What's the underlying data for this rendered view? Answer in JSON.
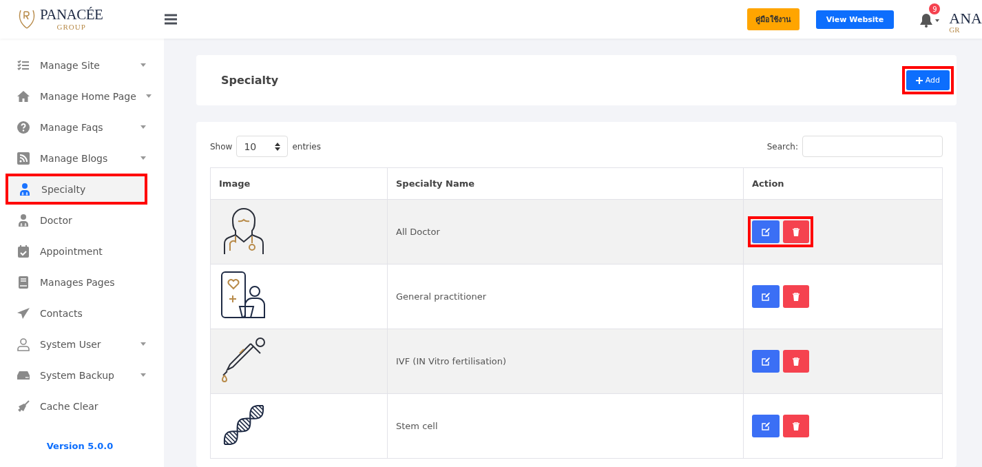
{
  "header": {
    "logo": {
      "name": "PANACÉE",
      "tagline": "GROUP"
    },
    "manual_button": "คู่มือใช้งาน",
    "website_button": "View Website",
    "notifications": {
      "count": "9"
    },
    "profile_logo": {
      "name": "ANA",
      "tagline": "GR"
    }
  },
  "sidebar": {
    "items": [
      {
        "label": "Manage Site",
        "has_submenu": true,
        "selected": false,
        "highlighted": false
      },
      {
        "label": "Manage Home Page",
        "has_submenu": true,
        "selected": false,
        "highlighted": false
      },
      {
        "label": "Manage Faqs",
        "has_submenu": true,
        "selected": false,
        "highlighted": false
      },
      {
        "label": "Manage Blogs",
        "has_submenu": true,
        "selected": false,
        "highlighted": false
      },
      {
        "label": "Specialty",
        "has_submenu": false,
        "selected": true,
        "highlighted": true
      },
      {
        "label": "Doctor",
        "has_submenu": false,
        "selected": false,
        "highlighted": false
      },
      {
        "label": "Appointment",
        "has_submenu": false,
        "selected": false,
        "highlighted": false
      },
      {
        "label": "Manages Pages",
        "has_submenu": false,
        "selected": false,
        "highlighted": false
      },
      {
        "label": "Contacts",
        "has_submenu": false,
        "selected": false,
        "highlighted": false
      },
      {
        "label": "System User",
        "has_submenu": true,
        "selected": false,
        "highlighted": false
      },
      {
        "label": "System Backup",
        "has_submenu": true,
        "selected": false,
        "highlighted": false
      },
      {
        "label": "Cache Clear",
        "has_submenu": false,
        "selected": false,
        "highlighted": false
      }
    ],
    "version": "Version 5.0.0"
  },
  "page_header": {
    "title": "Specialty",
    "add_button": {
      "label": "Add",
      "highlighted": true
    }
  },
  "table_controls": {
    "show_label": "Show",
    "page_size": "10",
    "entries_label": "entries",
    "search_label": "Search:"
  },
  "table": {
    "columns": [
      "Image",
      "Specialty Name",
      "Action"
    ],
    "rows": [
      {
        "kind": "doctor",
        "name": "All Doctor",
        "highlighted": true
      },
      {
        "kind": "telehealth",
        "name": "General practitioner",
        "highlighted": false
      },
      {
        "kind": "dropper",
        "name": "IVF (IN Vitro fertilisation)",
        "highlighted": false
      },
      {
        "kind": "dna",
        "name": "Stem cell",
        "highlighted": false
      }
    ]
  }
}
